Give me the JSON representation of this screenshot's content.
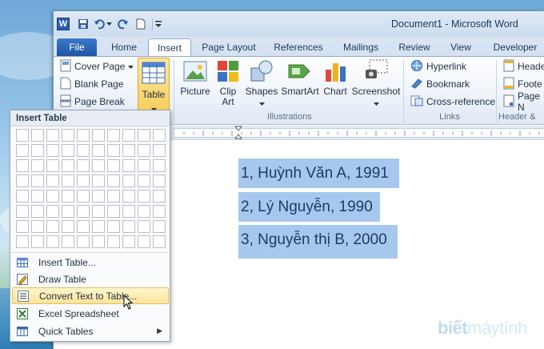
{
  "window": {
    "title": "Document1 - Microsoft Word"
  },
  "tabs": [
    {
      "label": "File"
    },
    {
      "label": "Home"
    },
    {
      "label": "Insert"
    },
    {
      "label": "Page Layout"
    },
    {
      "label": "References"
    },
    {
      "label": "Mailings"
    },
    {
      "label": "Review"
    },
    {
      "label": "View"
    },
    {
      "label": "Developer"
    }
  ],
  "ribbon": {
    "pages": {
      "cover_page": "Cover Page",
      "blank_page": "Blank Page",
      "page_break": "Page Break"
    },
    "table": {
      "label": "Table"
    },
    "illustrations": {
      "label": "Illustrations",
      "picture": "Picture",
      "clip_art_1": "Clip",
      "clip_art_2": "Art",
      "shapes": "Shapes",
      "smartart": "SmartArt",
      "chart": "Chart",
      "screenshot": "Screenshot"
    },
    "links": {
      "label": "Links",
      "hyperlink": "Hyperlink",
      "bookmark": "Bookmark",
      "cross_reference": "Cross-reference"
    },
    "header_footer": {
      "label": "Header &",
      "header": "Heade",
      "footer": "Foote",
      "page_number": "Page N"
    }
  },
  "document": {
    "lines": [
      "1, Huỳnh Văn A, 1991",
      "2, Lý Nguyễn, 1990",
      "3, Nguyễn thị B, 2000"
    ]
  },
  "menu": {
    "title": "Insert Table",
    "grid": {
      "cols": 10,
      "rows": 8
    },
    "items": [
      {
        "label": "Insert Table..."
      },
      {
        "label": "Draw Table"
      },
      {
        "label": "Convert Text to Table..."
      },
      {
        "label": "Excel Spreadsheet"
      },
      {
        "label": "Quick Tables"
      }
    ]
  },
  "watermark": {
    "bold": "biết",
    "light": "máytính"
  }
}
